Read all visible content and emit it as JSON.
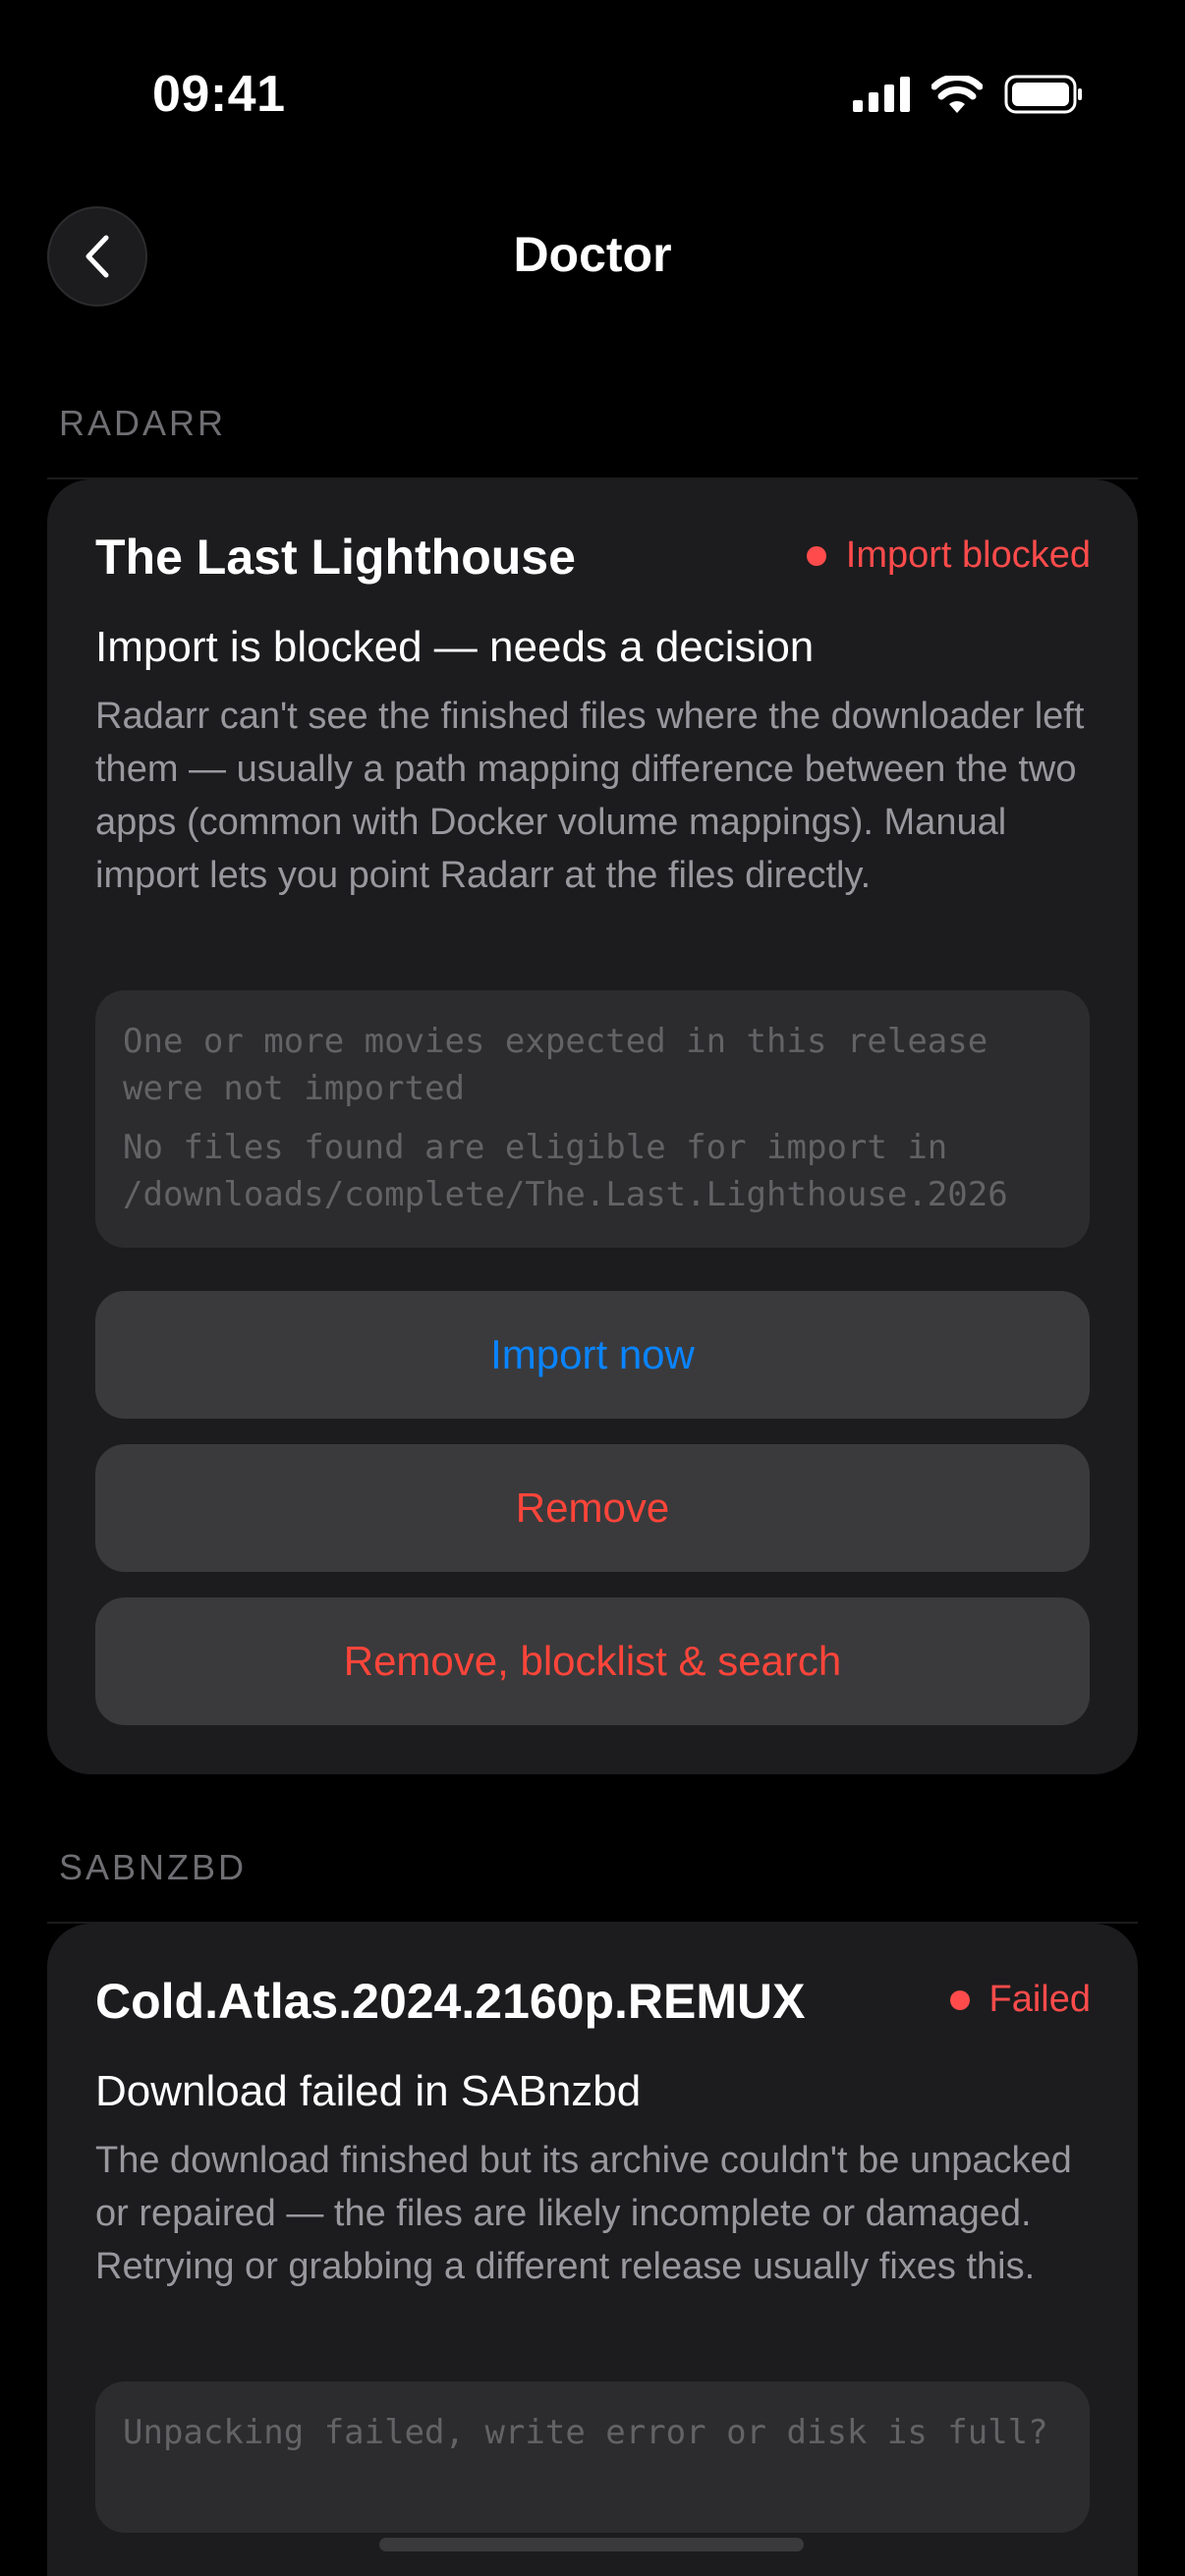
{
  "status_bar": {
    "time": "09:41"
  },
  "nav": {
    "title": "Doctor"
  },
  "sections": [
    {
      "header": "RADARR",
      "card": {
        "title": "The Last Lighthouse",
        "status": "Import blocked",
        "heading": "Import is blocked — needs a decision",
        "description": "Radarr can't see the finished files where the downloader left them — usually a path mapping difference between the two apps (common with Docker volume mappings). Manual import lets you point Radarr at the files directly.",
        "log_lines": [
          "One or more movies expected in this release were not imported",
          "No files found are eligible for import in /downloads/complete/The.Last.Lighthouse.2026"
        ],
        "actions": [
          "Import now",
          "Remove",
          "Remove, blocklist & search"
        ]
      }
    },
    {
      "header": "SABNZBD",
      "card": {
        "title": "Cold.Atlas.2024.2160p.REMUX",
        "status": "Failed",
        "heading": "Download failed in SABnzbd",
        "description": "The download finished but its archive couldn't be unpacked or repaired — the files are likely incomplete or damaged. Retrying or grabbing a different release usually fixes this.",
        "log_lines": [
          "Unpacking failed, write error or disk is full?"
        ]
      }
    }
  ],
  "colors": {
    "background": "#000000",
    "card": "#1c1c1e",
    "button": "#3a3a3c",
    "accent_blue": "#0a84ff",
    "danger_red": "#ff453a"
  },
  "icons": {
    "back": "chevron-left-icon",
    "signal": "cellular-signal-icon",
    "wifi": "wifi-icon",
    "battery": "battery-icon"
  }
}
